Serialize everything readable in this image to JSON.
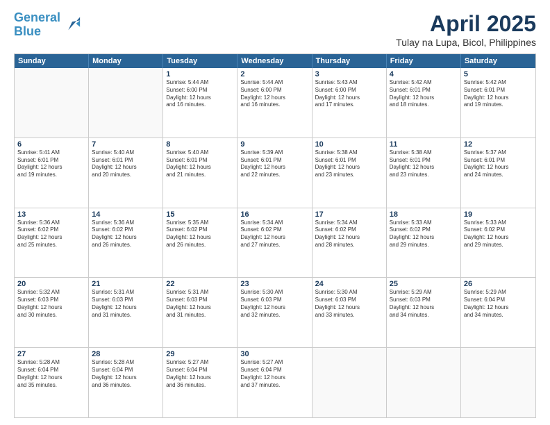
{
  "logo": {
    "line1": "General",
    "line2": "Blue"
  },
  "title": "April 2025",
  "subtitle": "Tulay na Lupa, Bicol, Philippines",
  "header_days": [
    "Sunday",
    "Monday",
    "Tuesday",
    "Wednesday",
    "Thursday",
    "Friday",
    "Saturday"
  ],
  "weeks": [
    [
      {
        "day": "",
        "info": ""
      },
      {
        "day": "",
        "info": ""
      },
      {
        "day": "1",
        "info": "Sunrise: 5:44 AM\nSunset: 6:00 PM\nDaylight: 12 hours\nand 16 minutes."
      },
      {
        "day": "2",
        "info": "Sunrise: 5:44 AM\nSunset: 6:00 PM\nDaylight: 12 hours\nand 16 minutes."
      },
      {
        "day": "3",
        "info": "Sunrise: 5:43 AM\nSunset: 6:00 PM\nDaylight: 12 hours\nand 17 minutes."
      },
      {
        "day": "4",
        "info": "Sunrise: 5:42 AM\nSunset: 6:01 PM\nDaylight: 12 hours\nand 18 minutes."
      },
      {
        "day": "5",
        "info": "Sunrise: 5:42 AM\nSunset: 6:01 PM\nDaylight: 12 hours\nand 19 minutes."
      }
    ],
    [
      {
        "day": "6",
        "info": "Sunrise: 5:41 AM\nSunset: 6:01 PM\nDaylight: 12 hours\nand 19 minutes."
      },
      {
        "day": "7",
        "info": "Sunrise: 5:40 AM\nSunset: 6:01 PM\nDaylight: 12 hours\nand 20 minutes."
      },
      {
        "day": "8",
        "info": "Sunrise: 5:40 AM\nSunset: 6:01 PM\nDaylight: 12 hours\nand 21 minutes."
      },
      {
        "day": "9",
        "info": "Sunrise: 5:39 AM\nSunset: 6:01 PM\nDaylight: 12 hours\nand 22 minutes."
      },
      {
        "day": "10",
        "info": "Sunrise: 5:38 AM\nSunset: 6:01 PM\nDaylight: 12 hours\nand 23 minutes."
      },
      {
        "day": "11",
        "info": "Sunrise: 5:38 AM\nSunset: 6:01 PM\nDaylight: 12 hours\nand 23 minutes."
      },
      {
        "day": "12",
        "info": "Sunrise: 5:37 AM\nSunset: 6:01 PM\nDaylight: 12 hours\nand 24 minutes."
      }
    ],
    [
      {
        "day": "13",
        "info": "Sunrise: 5:36 AM\nSunset: 6:02 PM\nDaylight: 12 hours\nand 25 minutes."
      },
      {
        "day": "14",
        "info": "Sunrise: 5:36 AM\nSunset: 6:02 PM\nDaylight: 12 hours\nand 26 minutes."
      },
      {
        "day": "15",
        "info": "Sunrise: 5:35 AM\nSunset: 6:02 PM\nDaylight: 12 hours\nand 26 minutes."
      },
      {
        "day": "16",
        "info": "Sunrise: 5:34 AM\nSunset: 6:02 PM\nDaylight: 12 hours\nand 27 minutes."
      },
      {
        "day": "17",
        "info": "Sunrise: 5:34 AM\nSunset: 6:02 PM\nDaylight: 12 hours\nand 28 minutes."
      },
      {
        "day": "18",
        "info": "Sunrise: 5:33 AM\nSunset: 6:02 PM\nDaylight: 12 hours\nand 29 minutes."
      },
      {
        "day": "19",
        "info": "Sunrise: 5:33 AM\nSunset: 6:02 PM\nDaylight: 12 hours\nand 29 minutes."
      }
    ],
    [
      {
        "day": "20",
        "info": "Sunrise: 5:32 AM\nSunset: 6:03 PM\nDaylight: 12 hours\nand 30 minutes."
      },
      {
        "day": "21",
        "info": "Sunrise: 5:31 AM\nSunset: 6:03 PM\nDaylight: 12 hours\nand 31 minutes."
      },
      {
        "day": "22",
        "info": "Sunrise: 5:31 AM\nSunset: 6:03 PM\nDaylight: 12 hours\nand 31 minutes."
      },
      {
        "day": "23",
        "info": "Sunrise: 5:30 AM\nSunset: 6:03 PM\nDaylight: 12 hours\nand 32 minutes."
      },
      {
        "day": "24",
        "info": "Sunrise: 5:30 AM\nSunset: 6:03 PM\nDaylight: 12 hours\nand 33 minutes."
      },
      {
        "day": "25",
        "info": "Sunrise: 5:29 AM\nSunset: 6:03 PM\nDaylight: 12 hours\nand 34 minutes."
      },
      {
        "day": "26",
        "info": "Sunrise: 5:29 AM\nSunset: 6:04 PM\nDaylight: 12 hours\nand 34 minutes."
      }
    ],
    [
      {
        "day": "27",
        "info": "Sunrise: 5:28 AM\nSunset: 6:04 PM\nDaylight: 12 hours\nand 35 minutes."
      },
      {
        "day": "28",
        "info": "Sunrise: 5:28 AM\nSunset: 6:04 PM\nDaylight: 12 hours\nand 36 minutes."
      },
      {
        "day": "29",
        "info": "Sunrise: 5:27 AM\nSunset: 6:04 PM\nDaylight: 12 hours\nand 36 minutes."
      },
      {
        "day": "30",
        "info": "Sunrise: 5:27 AM\nSunset: 6:04 PM\nDaylight: 12 hours\nand 37 minutes."
      },
      {
        "day": "",
        "info": ""
      },
      {
        "day": "",
        "info": ""
      },
      {
        "day": "",
        "info": ""
      }
    ]
  ]
}
